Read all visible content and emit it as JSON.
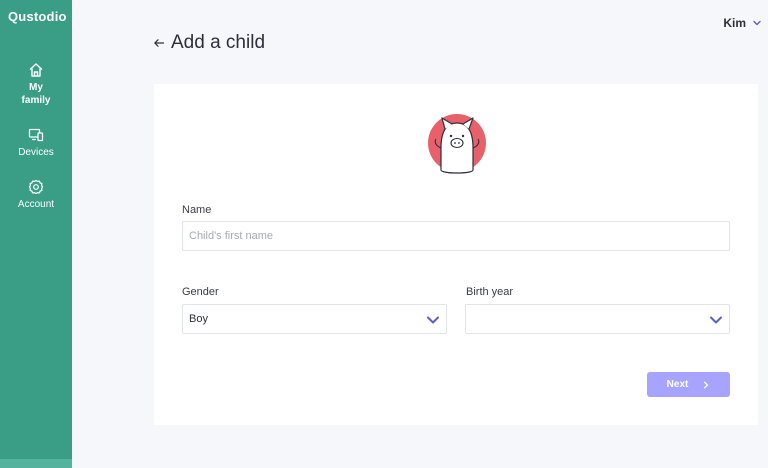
{
  "app": {
    "brand": "Qustodio"
  },
  "sidebar": {
    "items": [
      {
        "label_line1": "My",
        "label_line2": "family",
        "icon": "home-icon",
        "active": true
      },
      {
        "label": "Devices",
        "icon": "devices-icon"
      },
      {
        "label": "Account",
        "icon": "gear-icon"
      }
    ]
  },
  "header": {
    "user_name": "Kim",
    "title": "Add a child"
  },
  "form": {
    "name_label": "Name",
    "name_placeholder": "Child's first name",
    "name_value": "",
    "gender_label": "Gender",
    "gender_value": "Boy",
    "birth_year_label": "Birth year",
    "birth_year_value": "",
    "next_label": "Next"
  },
  "colors": {
    "sidebar": "#3a9e87",
    "accent": "#a6a4ff",
    "chevron": "#5b5fc7",
    "avatar_bg": "#e8606a"
  }
}
